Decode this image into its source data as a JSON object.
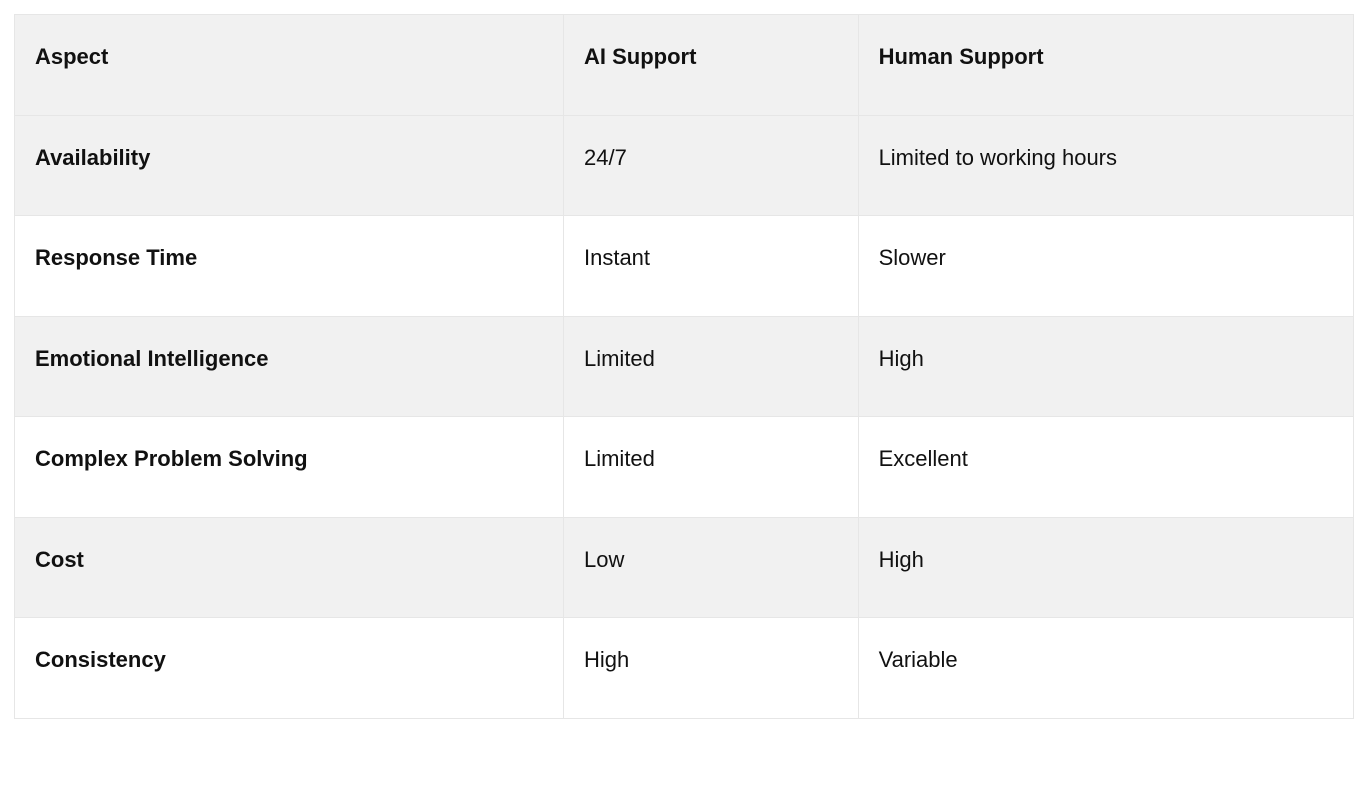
{
  "chart_data": {
    "type": "table",
    "columns": [
      "Aspect",
      "AI Support",
      "Human Support"
    ],
    "rows": [
      [
        "Availability",
        "24/7",
        "Limited to working hours"
      ],
      [
        "Response Time",
        "Instant",
        "Slower"
      ],
      [
        "Emotional Intelligence",
        "Limited",
        "High"
      ],
      [
        "Complex Problem Solving",
        "Limited",
        "Excellent"
      ],
      [
        "Cost",
        "Low",
        "High"
      ],
      [
        "Consistency",
        "High",
        "Variable"
      ]
    ]
  }
}
